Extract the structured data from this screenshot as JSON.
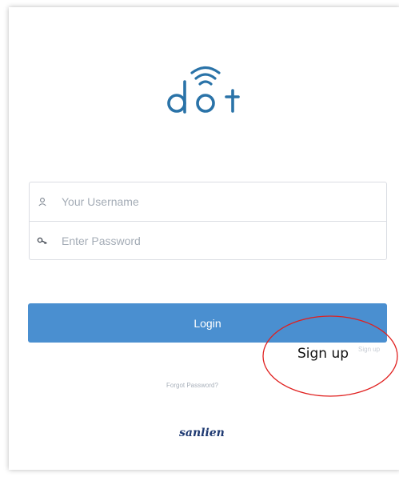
{
  "app": {
    "logo_text": "dot",
    "brand": "sanlien"
  },
  "login_form": {
    "username": {
      "value": "",
      "placeholder": "Your Username",
      "icon": "user-icon"
    },
    "password": {
      "value": "",
      "placeholder": "Enter Password",
      "icon": "key-icon"
    },
    "login_label": "Login"
  },
  "links": {
    "signup": "Sign up",
    "forgot_password": "Forgot Password?"
  },
  "annotation": {
    "text": "Sign up",
    "color": "#e0201f"
  },
  "colors": {
    "accent": "#4a8fd0",
    "logo": "#2a73a8",
    "brand": "#1f3a72"
  }
}
